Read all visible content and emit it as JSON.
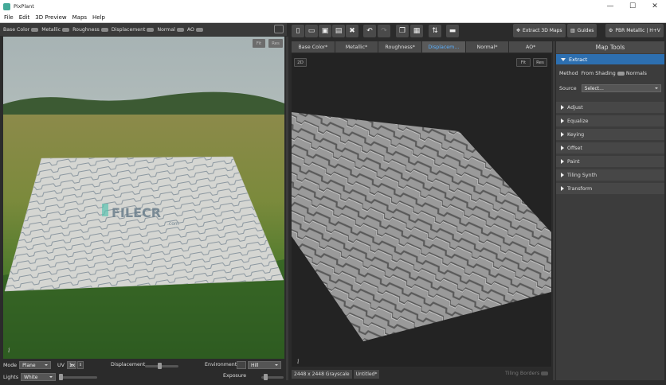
{
  "window": {
    "title": "PixPlant",
    "minimize": "—",
    "maximize": "☐",
    "close": "✕"
  },
  "menu": [
    "File",
    "Edit",
    "3D Preview",
    "Maps",
    "Help"
  ],
  "map_toggles": [
    "Base Color",
    "Metallic",
    "Roughness",
    "Displacement",
    "Normal",
    "AO"
  ],
  "preview": {
    "fit_label": "Fit",
    "res_label": "Res",
    "info_label": "i",
    "watermark": "FILECR",
    "watermark_sub": ".com"
  },
  "bottom_controls": {
    "mode_label": "Mode",
    "mode_value": "Plane",
    "uv_label": "UV",
    "uv_value": "1x",
    "displacement_label": "Displacement",
    "environment_label": "Environment",
    "environment_value": "Hill",
    "lights_label": "Lights",
    "lights_value": "White",
    "exposure_label": "Exposure",
    "displacement_level": 0.45,
    "lights_level": 0.05,
    "exposure_level": 0.2
  },
  "toolbar": {
    "extract_label": "Extract 3D Maps",
    "guides_label": "Guides",
    "pbr_label": "PBR Metallic | H+V"
  },
  "tabs": [
    {
      "label": "Base Color*",
      "active": false
    },
    {
      "label": "Metallic*",
      "active": false
    },
    {
      "label": "Roughness*",
      "active": false
    },
    {
      "label": "Displacem...",
      "active": true
    },
    {
      "label": "Normal*",
      "active": false
    },
    {
      "label": "AO*",
      "active": false
    }
  ],
  "view2d": {
    "mode_label": "2D",
    "fit_label": "Fit",
    "res_label": "Res",
    "info_label": "i"
  },
  "status": {
    "dims": "2448 x 2448 Grayscale",
    "name": "Untitled*",
    "tiling": "Tiling Borders"
  },
  "map_tools": {
    "title": "Map Tools",
    "extract_label": "Extract",
    "method_label": "Method",
    "method_from": "From Shading",
    "method_normals": "Normals",
    "source_label": "Source",
    "source_value": "Select...",
    "sections": [
      "Adjust",
      "Equalize",
      "Keying",
      "Offset",
      "Paint",
      "Tiling Synth",
      "Transform"
    ]
  },
  "colors": {
    "accent": "#2d6fb0",
    "active_tab_text": "#5ab0ff"
  }
}
